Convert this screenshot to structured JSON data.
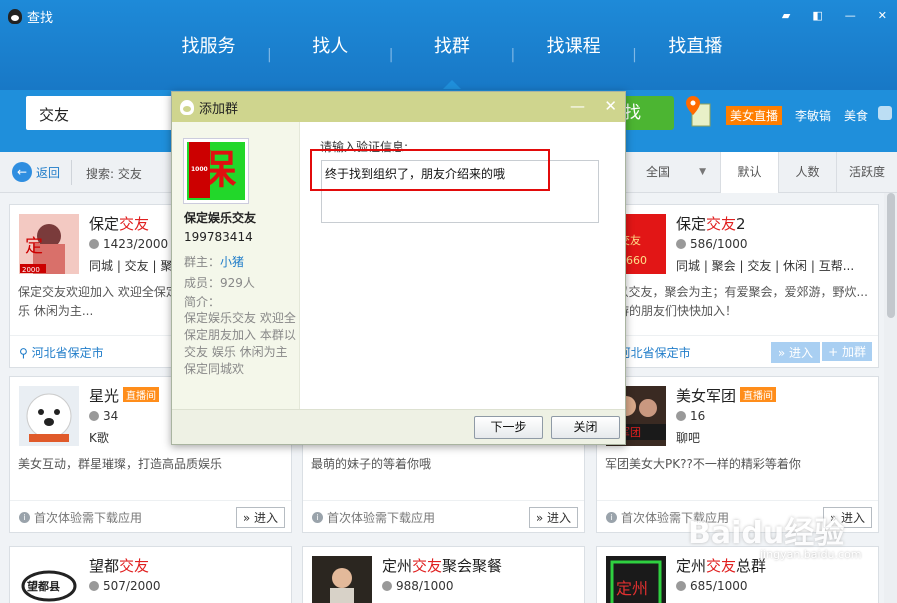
{
  "app": {
    "title": "查找"
  },
  "nav": {
    "items": [
      "找服务",
      "找人",
      "找群",
      "找课程",
      "找直播"
    ],
    "active": 2
  },
  "search": {
    "value": "交友",
    "button": "找"
  },
  "promo": {
    "label": "美女直播",
    "hint1": "李敏镐",
    "hint2": "美食"
  },
  "filter": {
    "back": "返回",
    "keyword": "搜索: 交友",
    "region": "全国",
    "sort": [
      "默认",
      "人数",
      "活跃度"
    ],
    "active_sort": 0
  },
  "dialog": {
    "title": "添加群",
    "group_avatar_text": "保",
    "group_avatar_level": "1000",
    "group_name": "保定娱乐交友",
    "group_id": "199783414",
    "owner_label": "群主：",
    "owner": "小猪",
    "members": "成员：929人",
    "intro_label": "简介：",
    "intro": "保定娱乐交友 欢迎全保定朋友加入 本群以交友 娱乐 休闲为主 保定同城欢",
    "prompt": "请输入验证信息:",
    "verify_text": "终于找到组织了，朋友介绍来的哦",
    "next": "下一步",
    "close": "关闭"
  },
  "cards": [
    {
      "name_pre": "保定",
      "name_hl": "交友",
      "name_post": "",
      "count": "1423/2000",
      "tags": "同城 | 交友 | 聚",
      "desc": "保定交友欢迎加入 欢迎全保定... 行 本群以交友 娱乐 休闲为主...",
      "loc": "河北省保定市",
      "avatar_text": "定",
      "avatar_badge": "2000"
    },
    {
      "name_pre": "保定",
      "name_hl": "交友",
      "name_post": "2",
      "count": "586/1000",
      "tags": "同城 | 聚会 | 交友 | 休闲 | 互帮...",
      "desc": "...以交友，聚会为主；有爱聚会，爱郊游，野炊... 驾游的朋友们快快加入！",
      "loc": "河北省保定市",
      "enter": "» 进入",
      "join": "+ 加群",
      "avatar_text": "定交友",
      "avatar_sub": "28660"
    },
    {
      "name": "星光",
      "badge": "直播间",
      "count": "34",
      "tags": "K歌",
      "desc": "美女互动，群星璀璨，打造高品质娱乐",
      "tip": "首次体验需下载应用",
      "enter": "» 进入"
    },
    {
      "desc": "最萌的妹子的等着你哦",
      "tip": "首次体验需下载应用",
      "enter": "» 进入"
    },
    {
      "name": "美女军团",
      "badge": "直播间",
      "count": "16",
      "tags": "聊吧",
      "desc": "军团美女大PK??不一样的精彩等着你",
      "tip": "首次体验需下载应用",
      "enter": "» 进入",
      "avatar_text": "女军团"
    },
    {
      "name_pre": "望都",
      "name_hl": "交友",
      "name_post": "",
      "count": "507/2000",
      "avatar_text": "望都县"
    },
    {
      "name_pre": "定州",
      "name_hl": "交友",
      "name_post": "聚会聚餐",
      "count": "988/1000"
    },
    {
      "name_pre": "定州",
      "name_hl": "交友",
      "name_post": "总群",
      "count": "685/1000",
      "avatar_text": "定州"
    }
  ],
  "watermark": {
    "text": "Baidu经验",
    "sub": "jingyan.baidu.com"
  },
  "colors": {
    "brand": "#1f8fdb",
    "accent_red": "#e02020",
    "dialog_head": "#cfd58e",
    "green": "#4cb532"
  }
}
